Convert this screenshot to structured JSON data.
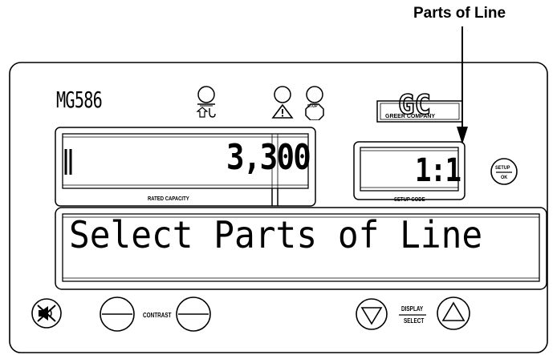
{
  "callout": {
    "label": "Parts of Line"
  },
  "panel": {
    "model": "MG586",
    "brand": {
      "logo_text": "G.C",
      "name": "GREER COMPANY"
    },
    "indicators": [
      {
        "icon": "lift-hook-icon"
      },
      {
        "icon": "warning-triangle-icon"
      },
      {
        "icon": "stop-icon",
        "text": "STOP"
      }
    ],
    "rated_capacity": {
      "value": "3,300",
      "label": "RATED CAPACITY"
    },
    "setup_code": {
      "value": "1:1",
      "label": "SETUP CODE"
    },
    "setup_ok_button": {
      "top": "SETUP",
      "bottom": "OK"
    },
    "message": "Select Parts of Line",
    "contrast_label": "CONTRAST",
    "display_select": {
      "top": "DISPLAY",
      "bottom": "SELECT"
    }
  }
}
